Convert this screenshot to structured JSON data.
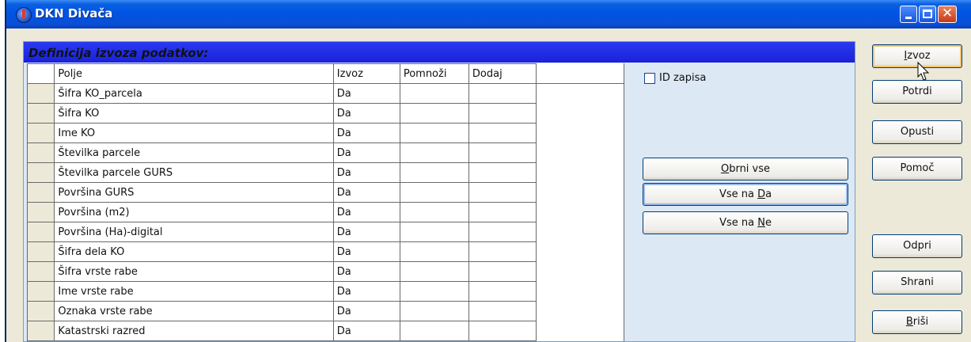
{
  "window": {
    "title": "DKN Divača"
  },
  "panel": {
    "title": "Definicija izvoza podatkov:"
  },
  "grid": {
    "columns": [
      "Polje",
      "Izvoz",
      "Pomnoži",
      "Dodaj"
    ],
    "rows": [
      [
        "Šifra KO_parcela",
        "Da",
        "",
        ""
      ],
      [
        "Šifra KO",
        "Da",
        "",
        ""
      ],
      [
        "Ime KO",
        "Da",
        "",
        ""
      ],
      [
        "Številka parcele",
        "Da",
        "",
        ""
      ],
      [
        "Številka parcele GURS",
        "Da",
        "",
        ""
      ],
      [
        "Površina GURS",
        "Da",
        "",
        ""
      ],
      [
        "Površina (m2)",
        "Da",
        "",
        ""
      ],
      [
        "Površina (Ha)-digital",
        "Da",
        "",
        ""
      ],
      [
        "Šifra dela KO",
        "Da",
        "",
        ""
      ],
      [
        "Šifra vrste rabe",
        "Da",
        "",
        ""
      ],
      [
        "Ime vrste rabe",
        "Da",
        "",
        ""
      ],
      [
        "Oznaka vrste rabe",
        "Da",
        "",
        ""
      ],
      [
        "Katastrski razred",
        "Da",
        "",
        ""
      ]
    ]
  },
  "checkbox": {
    "label": "ID zapisa",
    "checked": false
  },
  "middle_buttons": {
    "obrni": {
      "pre": "",
      "key": "O",
      "post": "brni vse"
    },
    "vse_da": {
      "pre": "Vse na ",
      "key": "D",
      "post": "a"
    },
    "vse_ne": {
      "pre": "Vse na ",
      "key": "N",
      "post": "e"
    }
  },
  "right_buttons": {
    "izvoz": {
      "pre": "",
      "key": "I",
      "post": "zvoz"
    },
    "potrdi": "Potrdi",
    "opusti": "Opusti",
    "pomoc": "Pomoč",
    "odpri": "Odpri",
    "shrani": "Shrani",
    "brisi": {
      "pre": "",
      "key": "B",
      "post": "riši"
    }
  },
  "icons": [
    "app-globe-icon",
    "minimize-icon",
    "maximize-icon",
    "close-icon",
    "mouse-cursor-icon"
  ],
  "colors": {
    "titlebar": "#0054e3",
    "panel_header": "#1a22d8",
    "panel_bg": "#dde8f5"
  }
}
